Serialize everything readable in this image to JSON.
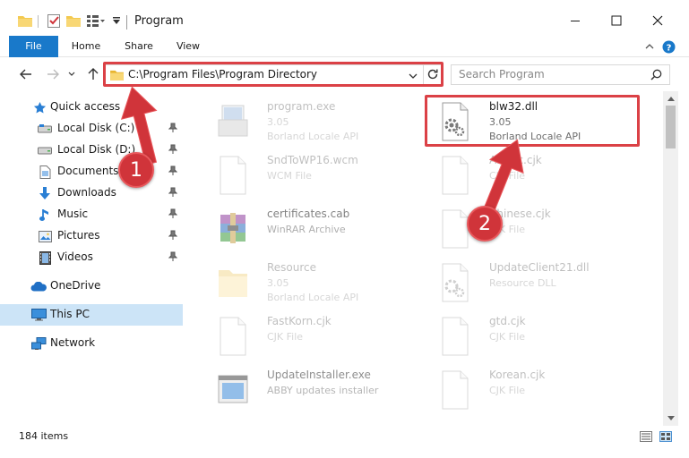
{
  "window": {
    "title": "Program",
    "minimize_icon": "minimize-icon",
    "maximize_icon": "maximize-icon",
    "close_icon": "close-icon"
  },
  "ribbon": {
    "tabs": [
      {
        "label": "File"
      },
      {
        "label": "Home"
      },
      {
        "label": "Share"
      },
      {
        "label": "View"
      }
    ]
  },
  "address": {
    "path": "C:\\Program Files\\Program Directory",
    "search_placeholder": "Search Program"
  },
  "nav": {
    "items": [
      {
        "label": "Quick access",
        "icon": "star-icon"
      },
      {
        "label": "Local Disk (C:)",
        "icon": "drive-icon",
        "pinned": true
      },
      {
        "label": "Local Disk (D:)",
        "icon": "drive-icon",
        "pinned": true
      },
      {
        "label": "Documents",
        "icon": "documents-icon",
        "pinned": true
      },
      {
        "label": "Downloads",
        "icon": "downloads-icon",
        "pinned": true
      },
      {
        "label": "Music",
        "icon": "music-icon",
        "pinned": true
      },
      {
        "label": "Pictures",
        "icon": "pictures-icon",
        "pinned": true
      },
      {
        "label": "Videos",
        "icon": "videos-icon",
        "pinned": true
      },
      {
        "label": "OneDrive",
        "icon": "cloud-icon"
      },
      {
        "label": "This PC",
        "icon": "computer-icon",
        "selected": true
      },
      {
        "label": "Network",
        "icon": "network-icon"
      }
    ]
  },
  "files": [
    {
      "name": "program.exe",
      "line2": "3.05",
      "line3": "Borland Locale API",
      "icon": "exe-icon"
    },
    {
      "name": "blw32.dll",
      "line2": "3.05",
      "line3": "Borland Locale API",
      "icon": "dll-icon",
      "highlighted": true
    },
    {
      "name": "SndToWP16.wcm",
      "line2": "WCM File",
      "line3": "",
      "icon": "blank-file-icon"
    },
    {
      "name": "Arabic.cjk",
      "line2": "CJK File",
      "line3": "",
      "icon": "blank-file-icon"
    },
    {
      "name": "certificates.cab",
      "line2": "WinRAR Archive",
      "line3": "",
      "icon": "archive-icon"
    },
    {
      "name": "Chinese.cjk",
      "line2": "CJK File",
      "line3": "",
      "icon": "blank-file-icon"
    },
    {
      "name": "Resource",
      "line2": "3.05",
      "line3": "Borland Locale API",
      "icon": "exe-icon"
    },
    {
      "name": "UpdateClient21.dll",
      "line2": "Resource DLL",
      "line3": "",
      "icon": "dll-icon"
    },
    {
      "name": "FastKorn.cjk",
      "line2": "CJK File",
      "line3": "",
      "icon": "blank-file-icon"
    },
    {
      "name": "gtd.cjk",
      "line2": "CJK File",
      "line3": "",
      "icon": "blank-file-icon"
    },
    {
      "name": "UpdateInstaller.exe",
      "line2": "ABBY updates installer",
      "line3": "",
      "icon": "installer-icon"
    },
    {
      "name": "Korean.cjk",
      "line2": "CJK File",
      "line3": "",
      "icon": "blank-file-icon"
    }
  ],
  "status": {
    "item_count": "184 items"
  },
  "annotations": {
    "step1": "1",
    "step2": "2"
  },
  "colors": {
    "accent": "#1979ca",
    "highlight": "#db4146",
    "selected": "#cce4f7"
  }
}
